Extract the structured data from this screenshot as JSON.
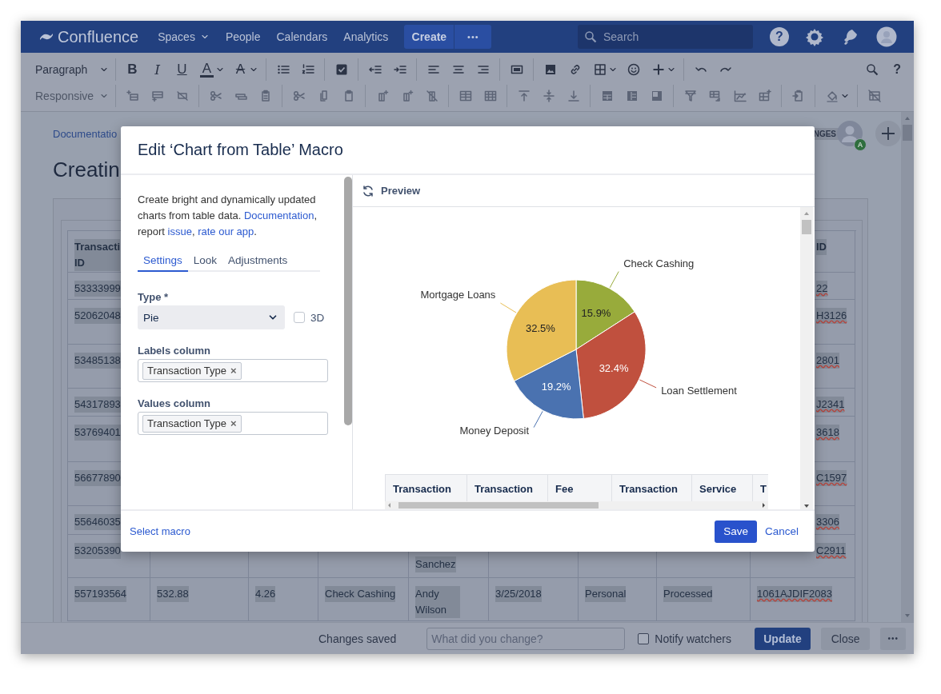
{
  "nav": {
    "product": "Confluence",
    "items": [
      {
        "label": "Spaces",
        "dropdown": true
      },
      {
        "label": "People",
        "dropdown": false
      },
      {
        "label": "Calendars",
        "dropdown": false
      },
      {
        "label": "Analytics",
        "dropdown": false
      }
    ],
    "create_label": "Create",
    "more_label": "•••",
    "search": {
      "placeholder": "Search"
    },
    "help_label": "?"
  },
  "editor_toolbar": {
    "paragraph_style": "Paragraph",
    "text_buttons": [
      {
        "label": "B",
        "kind": "bold"
      },
      {
        "label": "I",
        "kind": "italic"
      },
      {
        "label": "U",
        "kind": "underline"
      },
      {
        "label": "A",
        "kind": "color"
      },
      {
        "label": "A",
        "kind": "style"
      }
    ],
    "help_label": "?",
    "table_mode": "Responsive"
  },
  "page": {
    "breadcrumb": "Documentatio",
    "title": "Creatin",
    "status_badge": "NGES",
    "avatar_badge": "A",
    "table": {
      "text_selected": true,
      "header": {
        "column_1": {
          "text": "Transacti\nID"
        },
        "column_9": {
          "text": "ID",
          "misspelled": false
        }
      },
      "rows": [
        {
          "column_1": {
            "text": "53333999"
          },
          "column_9": {
            "text": "22",
            "misspelled": true
          }
        },
        {
          "column_1": {
            "text": "52062048"
          },
          "column_9": {
            "text": "H3126",
            "misspelled": true
          }
        },
        {
          "column_1": {
            "text": "53485138"
          },
          "column_9": {
            "text": "2801",
            "misspelled": true
          }
        },
        {
          "column_1": {
            "text": "54317893"
          },
          "column_9": {
            "text": "J2341",
            "misspelled": true
          }
        },
        {
          "column_1": {
            "text": "53769401"
          },
          "column_9": {
            "text": "3618",
            "misspelled": true
          }
        },
        {
          "column_1": {
            "text": "56677890"
          },
          "column_9": {
            "text": "C1597",
            "misspelled": true
          }
        },
        {
          "column_1": {
            "text": "55646035"
          },
          "column_9": {
            "text": "3306",
            "misspelled": true
          }
        },
        {
          "column_1": {
            "text": "53205390"
          },
          "column_5": {
            "text": "Sanchez"
          },
          "column_9": {
            "text": "C2911",
            "misspelled": true
          }
        },
        {
          "column_1": {
            "text": "557193564"
          },
          "column_2": {
            "text": "532.88"
          },
          "column_3": {
            "text": "4.26"
          },
          "column_4": {
            "text": "Check Cashing"
          },
          "column_5": {
            "text": "Andy Wilson"
          },
          "column_6": {
            "text": "3/25/2018"
          },
          "column_7": {
            "text": "Personal"
          },
          "column_8": {
            "text": "Processed"
          },
          "column_9": {
            "text": "1061AJDIF2083",
            "misspelled": true
          }
        }
      ]
    }
  },
  "bottom_bar": {
    "status": "Changes saved",
    "comment": {
      "placeholder": "What did you change?"
    },
    "notify": {
      "label": "Notify watchers",
      "checked": false
    },
    "update_label": "Update",
    "close_label": "Close",
    "more_label": "•••"
  },
  "macro_dialog": {
    "title": "Edit ‘Chart from Table’ Macro",
    "description": [
      {
        "text": "Create bright and dynamically updated charts from table data. ",
        "link": false
      },
      {
        "text": "Documentation",
        "link": true
      },
      {
        "text": ", report ",
        "link": false
      },
      {
        "text": "issue",
        "link": true
      },
      {
        "text": ", ",
        "link": false
      },
      {
        "text": "rate our app",
        "link": true
      },
      {
        "text": ".",
        "link": false
      }
    ],
    "tabs": [
      {
        "label": "Settings",
        "selected": true
      },
      {
        "label": "Look",
        "selected": false
      },
      {
        "label": "Adjustments",
        "selected": false
      }
    ],
    "type": {
      "label": "Type *",
      "value": "Pie"
    },
    "three_d": {
      "label": "3D",
      "checked": false
    },
    "labels_column": {
      "label": "Labels column",
      "tags": [
        {
          "text": "Transaction Type",
          "remove": "×"
        }
      ]
    },
    "values_column": {
      "label": "Values column",
      "tags": [
        {
          "text": "Transaction Type",
          "remove": "×"
        }
      ]
    },
    "preview": {
      "label": "Preview",
      "chart_data": {
        "type": "pie",
        "categories": [
          "Check Cashing",
          "Loan Settlement",
          "Money Deposit",
          "Mortgage Loans"
        ],
        "values": [
          15.9,
          32.4,
          19.2,
          32.5
        ],
        "colors": [
          "#98ab3b",
          "#c0503e",
          "#4a72b0",
          "#e8be55"
        ],
        "value_labels": [
          "15.9%",
          "32.4%",
          "19.2%",
          "32.5%"
        ]
      },
      "table": {
        "columns": [
          "Transaction",
          "Transaction",
          "Fee",
          "Transaction",
          "Service",
          "T"
        ]
      }
    },
    "select_macro_label": "Select macro",
    "save_label": "Save",
    "cancel_label": "Cancel"
  }
}
